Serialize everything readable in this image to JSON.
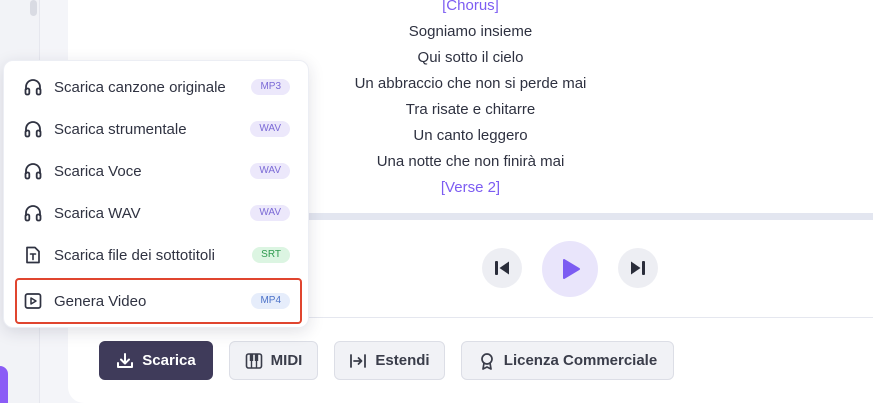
{
  "lyrics": {
    "lines": [
      {
        "text": "[Chorus]",
        "kind": "tag"
      },
      {
        "text": "Sogniamo insieme",
        "kind": "line"
      },
      {
        "text": "Qui sotto il cielo",
        "kind": "line"
      },
      {
        "text": "Un abbraccio che non si perde mai",
        "kind": "line"
      },
      {
        "text": "Tra risate e chitarre",
        "kind": "line"
      },
      {
        "text": "Un canto leggero",
        "kind": "line"
      },
      {
        "text": "Una notte che non finirà mai",
        "kind": "line"
      },
      {
        "text": "[Verse 2]",
        "kind": "tag"
      }
    ]
  },
  "download_menu": {
    "items": [
      {
        "label": "Scarica canzone originale",
        "badge": "MP3",
        "icon": "headphones-icon"
      },
      {
        "label": "Scarica strumentale",
        "badge": "WAV",
        "icon": "headphones-icon"
      },
      {
        "label": "Scarica Voce",
        "badge": "WAV",
        "icon": "headphones-icon"
      },
      {
        "label": "Scarica WAV",
        "badge": "WAV",
        "icon": "headphones-icon"
      },
      {
        "label": "Scarica file dei sottotitoli",
        "badge": "SRT",
        "icon": "subtitle-file-icon"
      },
      {
        "label": "Genera Video",
        "badge": "MP4",
        "icon": "video-play-icon"
      }
    ]
  },
  "player": {
    "prev_icon": "skip-previous-icon",
    "play_icon": "play-icon",
    "next_icon": "skip-next-icon"
  },
  "actions": {
    "download_label": "Scarica",
    "midi_label": "MIDI",
    "extend_label": "Estendi",
    "license_label": "Licenza Commerciale"
  },
  "colors": {
    "accent": "#7c5cf2",
    "dark_button": "#3f3b5a",
    "highlight": "#e0452f"
  }
}
